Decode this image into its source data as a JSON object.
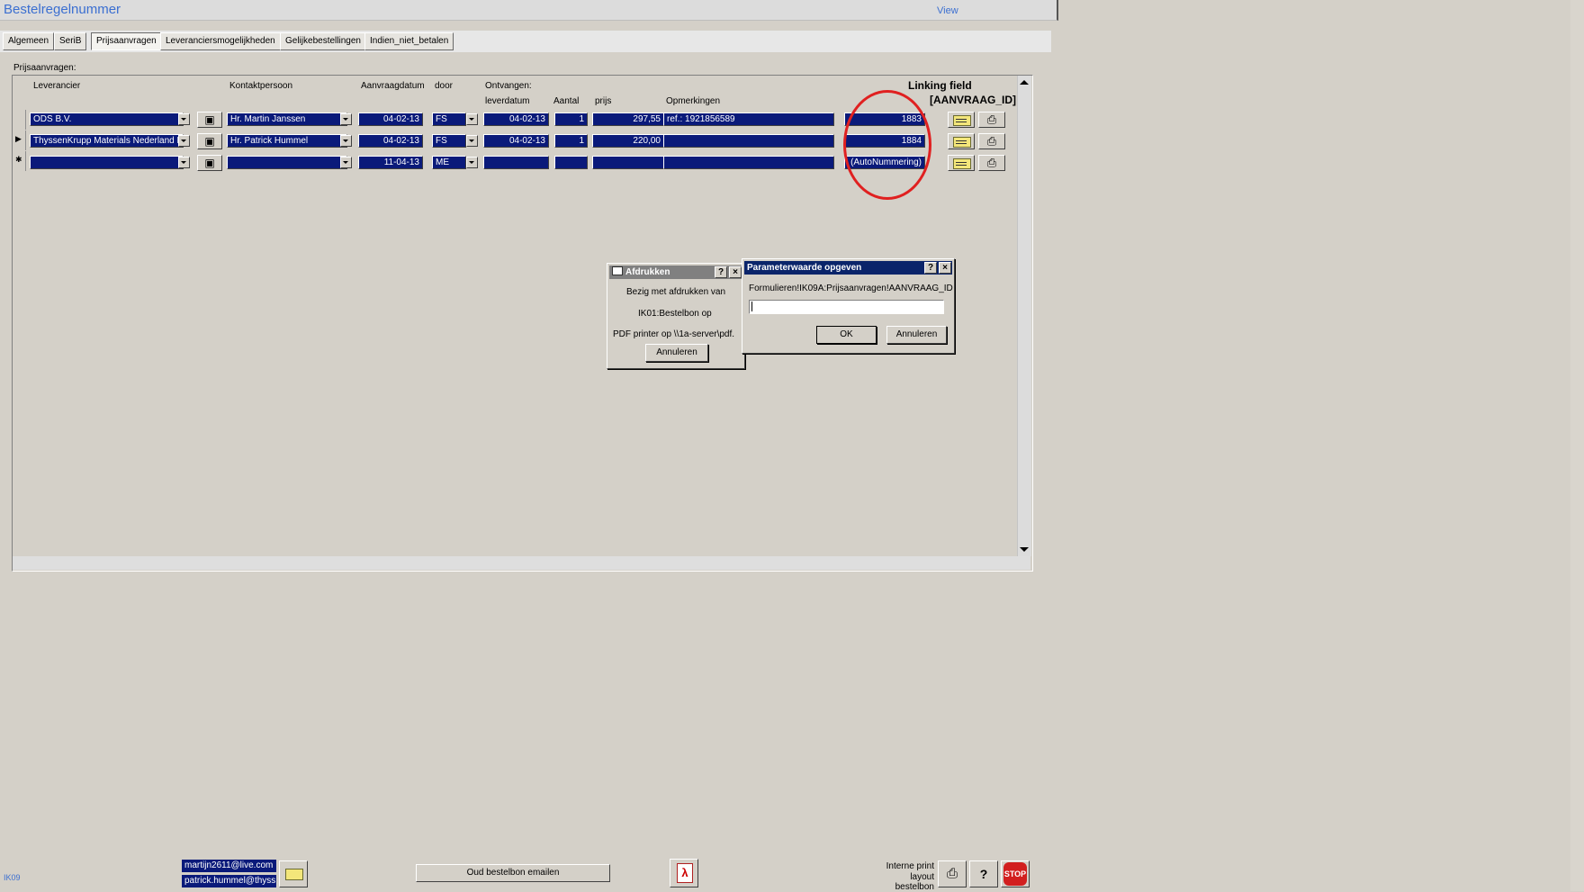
{
  "window": {
    "title": "Bestelregelnummer",
    "view_link": "View"
  },
  "tabs": [
    {
      "label": "Algemeen",
      "active": false
    },
    {
      "label": "SeriB",
      "active": false
    },
    {
      "label": "Prijsaanvragen",
      "active": true
    },
    {
      "label": "Leveranciersmogelijkheden",
      "active": false
    },
    {
      "label": "Gelijkebestellingen",
      "active": false
    },
    {
      "label": "Indien_niet_betalen",
      "active": false
    }
  ],
  "subform": {
    "label": "Prijsaanvragen:",
    "headers": {
      "leverancier": "Leverancier",
      "kontaktpersoon": "Kontaktpersoon",
      "aanvraagdatum": "Aanvraagdatum",
      "door": "door",
      "ontvangen": "Ontvangen:",
      "leverdatum": "leverdatum",
      "aantal": "Aantal",
      "prijs": "prijs",
      "opmerkingen": "Opmerkingen"
    },
    "annotation": {
      "line1": "Linking field",
      "line2": "[AANVRAAG_ID]"
    },
    "rows": [
      {
        "selector": "",
        "leverancier": "ODS  B.V.",
        "kontaktpersoon": "Hr. Martin Janssen",
        "aanvraagdatum": "04-02-13",
        "door": "FS",
        "leverdatum": "04-02-13",
        "aantal": "1",
        "prijs": "297,55",
        "opmerkingen": "ref.: 1921856589",
        "aanvraag_id": "1883"
      },
      {
        "selector": "▶",
        "leverancier": "ThyssenKrupp Materials Nederland B",
        "kontaktpersoon": "Hr. Patrick Hummel",
        "aanvraagdatum": "04-02-13",
        "door": "FS",
        "leverdatum": "04-02-13",
        "aantal": "1",
        "prijs": "220,00",
        "opmerkingen": "",
        "aanvraag_id": "1884"
      },
      {
        "selector": "✱",
        "leverancier": "",
        "kontaktpersoon": "",
        "aanvraagdatum": "11-04-13",
        "door": "ME",
        "leverdatum": "",
        "aantal": "",
        "prijs": "",
        "opmerkingen": "",
        "aanvraag_id": "(AutoNummering)"
      }
    ]
  },
  "dialog_print": {
    "title": "Afdrukken",
    "line1": "Bezig met afdrukken van",
    "line2": "IK01:Bestelbon op",
    "line3": "PDF printer op \\\\1a-server\\pdf.",
    "cancel": "Annuleren"
  },
  "dialog_param": {
    "title": "Parameterwaarde opgeven",
    "prompt": "Formulieren!IK09A:Prijsaanvragen!AANVRAAG_ID",
    "value": "",
    "ok": "OK",
    "cancel": "Annuleren"
  },
  "footer": {
    "form_code": "IK09",
    "emails": [
      "martijn2611@live.com",
      "patrick.hummel@thyss"
    ],
    "old_order_email_button": "Oud bestelbon emailen",
    "internal_print_label_1": "Interne print",
    "internal_print_label_2": "layout bestelbon",
    "stop_label": "STOP",
    "help_label": "?"
  },
  "colors": {
    "selected_field_bg": "#0a1a7a",
    "title_text": "#3b6fd1",
    "highlight_circle": "#e02020",
    "dialog_title_active": "#0a246a"
  }
}
